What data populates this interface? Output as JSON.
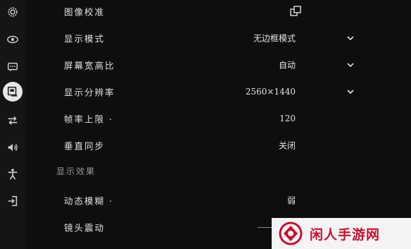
{
  "sidebar": {
    "items": [
      {
        "icon": "gear-icon"
      },
      {
        "icon": "eye-icon"
      },
      {
        "icon": "chat-icon"
      },
      {
        "icon": "display-icon",
        "active": true
      },
      {
        "icon": "arrows-swap-icon"
      },
      {
        "icon": "speaker-icon"
      },
      {
        "icon": "accessibility-icon"
      },
      {
        "icon": "login-icon"
      }
    ]
  },
  "settings": {
    "rows": [
      {
        "label": "图像校准",
        "value": "",
        "control": "external-link"
      },
      {
        "label": "显示模式",
        "value": "无边框模式",
        "control": "dropdown"
      },
      {
        "label": "屏幕宽高比",
        "value": "自动",
        "control": "dropdown"
      },
      {
        "label": "显示分辨率",
        "value": "2560×1440",
        "control": "dropdown"
      },
      {
        "label": "帧率上限 ·",
        "value": "120",
        "control": "slider"
      },
      {
        "label": "垂直同步",
        "value": "关闭",
        "control": "toggle"
      },
      {
        "label": "动态模糊 ·",
        "value": "弱",
        "control": "slider"
      },
      {
        "label": "镜头震动",
        "value": "",
        "control": "slider"
      }
    ],
    "section_header": "显示效果"
  },
  "watermark": {
    "brand_text": "闲人手游网",
    "brand_color": "#c8102e"
  }
}
